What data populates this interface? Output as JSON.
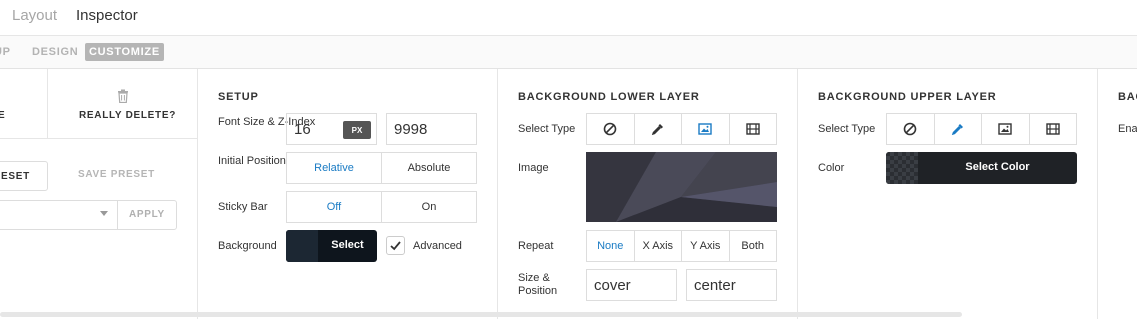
{
  "topbar": {
    "tabs": [
      "Layout",
      "Inspector"
    ]
  },
  "subnav": {
    "setup": "UP",
    "design": "DESIGN",
    "customize": "CUSTOMIZE"
  },
  "presets": {
    "delete_fragment": "E",
    "really_delete": "REALLY DELETE?",
    "reset_label": "ESET",
    "save_preset": "SAVE PRESET",
    "apply": "APPLY"
  },
  "setup": {
    "title": "SETUP",
    "font_size_label": "Font Size & Z-Index",
    "font_size_value": "16",
    "unit": "PX",
    "z_index_value": "9998",
    "initial_position_label": "Initial Position",
    "position_options": [
      "Relative",
      "Absolute"
    ],
    "position_selected": "Relative",
    "sticky_bar_label": "Sticky Bar",
    "sticky_options": [
      "Off",
      "On"
    ],
    "sticky_selected": "Off",
    "background_label": "Background",
    "background_button": "Select",
    "advanced_label": "Advanced",
    "advanced_checked": true
  },
  "bg_lower": {
    "title": "BACKGROUND LOWER LAYER",
    "select_type_label": "Select Type",
    "types": [
      "none-icon",
      "eyedropper-icon",
      "image-icon",
      "video-icon"
    ],
    "selected_type": "image-icon",
    "image_label": "Image",
    "repeat_label": "Repeat",
    "repeat_options": [
      "None",
      "X Axis",
      "Y Axis",
      "Both"
    ],
    "repeat_selected": "None",
    "size_position_label": "Size & Position",
    "size_value": "cover",
    "position_value": "center"
  },
  "bg_upper": {
    "title": "BACKGROUND UPPER LAYER",
    "select_type_label": "Select Type",
    "types": [
      "none-icon",
      "eyedropper-icon",
      "image-icon",
      "video-icon"
    ],
    "selected_type": "eyedropper-icon",
    "color_label": "Color",
    "color_button": "Select Color"
  },
  "next_panel": {
    "title": "BAC",
    "label": "Enal"
  },
  "colors": {
    "accent": "#1a7bc4",
    "dark_button": "#0e151d"
  }
}
